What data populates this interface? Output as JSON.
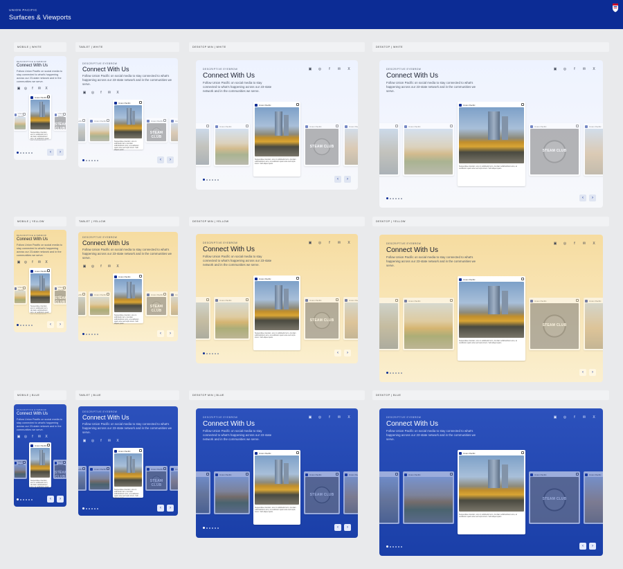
{
  "header": {
    "brand": "UNION PACIFIC",
    "title": "Surfaces & Viewports"
  },
  "content": {
    "eyebrow": "DESCRIPTIVE EYEBROW",
    "heading": "Connect With Us",
    "body": "Follow Union Pacific on social media to stay connected to what's happening across our 23-state network and in the communities we serve.",
    "card_account": "Union Pacific",
    "card_caption": "Suspendisse interdum, arcu in sollicitudin ferm, dui diam sollicitudinium arcu, at vestibulum quam ante sed turpis lorem. Velit aliquet quam.",
    "steam_label": "STEAM CLUB",
    "prev": "‹",
    "next": "›",
    "socials": [
      "youtube-icon",
      "instagram-icon",
      "facebook-icon",
      "email-icon",
      "x-icon"
    ],
    "social_glyphs": [
      "▣",
      "◎",
      "f",
      "✉",
      "X"
    ]
  },
  "labels": {
    "mobile_white": "MOBILE | WHITE",
    "tablet_white": "TABLET | WHITE",
    "dmin_white": "DESKTOP MIN | WHITE",
    "desk_white": "DESKTOP | WHITE",
    "mobile_yellow": "MOBILE | YELLOW",
    "tablet_yellow": "TABLET | YELLOW",
    "dmin_yellow": "DESKTOP MIN | YELLOW",
    "desk_yellow": "DESKTOP | YELLOW",
    "mobile_blue": "MOBILE | BLUE",
    "tablet_blue": "TABLET | BLUE",
    "dmin_blue": "DESKTOP MIN | BLUE",
    "desk_blue": "DESKTOP | BLUE"
  },
  "colors": {
    "brand": "#0c2c95",
    "white_surface": "#eef3ff",
    "yellow_surface": "#f6dca0",
    "blue_surface": "#2c51bc"
  }
}
